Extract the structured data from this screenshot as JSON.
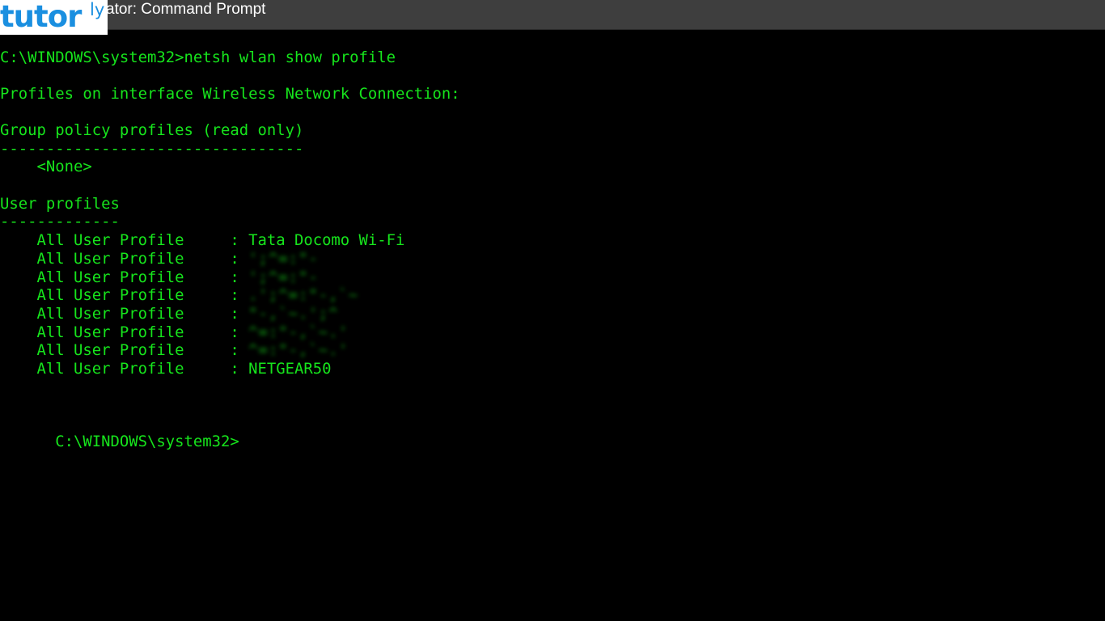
{
  "window": {
    "title": "ator: Command Prompt"
  },
  "watermark": {
    "main": "tutor",
    "sup": "ly"
  },
  "console": {
    "command_line": "C:\\WINDOWS\\system32>netsh wlan show profile",
    "interface_heading": "Profiles on interface Wireless Network Connection:",
    "group_policy_heading": "Group policy profiles (read only)",
    "group_policy_rule": "---------------------------------",
    "group_policy_value": "    <None>",
    "user_profiles_heading": "User profiles",
    "user_profiles_rule": "-------------",
    "profiles": [
      {
        "label": "    All User Profile     : ",
        "name": "Tata Docomo Wi-Fi",
        "obscured": false
      },
      {
        "label": "    All User Profile     : ",
        "name": "       ",
        "obscured": true
      },
      {
        "label": "    All User Profile     : ",
        "name": "       ",
        "obscured": true
      },
      {
        "label": "    All User Profile     : ",
        "name": "           ",
        "obscured": true
      },
      {
        "label": "    All User Profile     : ",
        "name": "         ",
        "obscured": true
      },
      {
        "label": "    All User Profile     : ",
        "name": "          ",
        "obscured": true
      },
      {
        "label": "    All User Profile     : ",
        "name": "          ",
        "obscured": true
      },
      {
        "label": "    All User Profile     : ",
        "name": "NETGEAR50",
        "obscured": false
      }
    ],
    "prompt": "C:\\WINDOWS\\system32>"
  },
  "colors": {
    "console_text": "#16e41c",
    "console_background": "#000000",
    "titlebar": "#3e3e3e",
    "watermark_blue": "#1a8fe0"
  }
}
